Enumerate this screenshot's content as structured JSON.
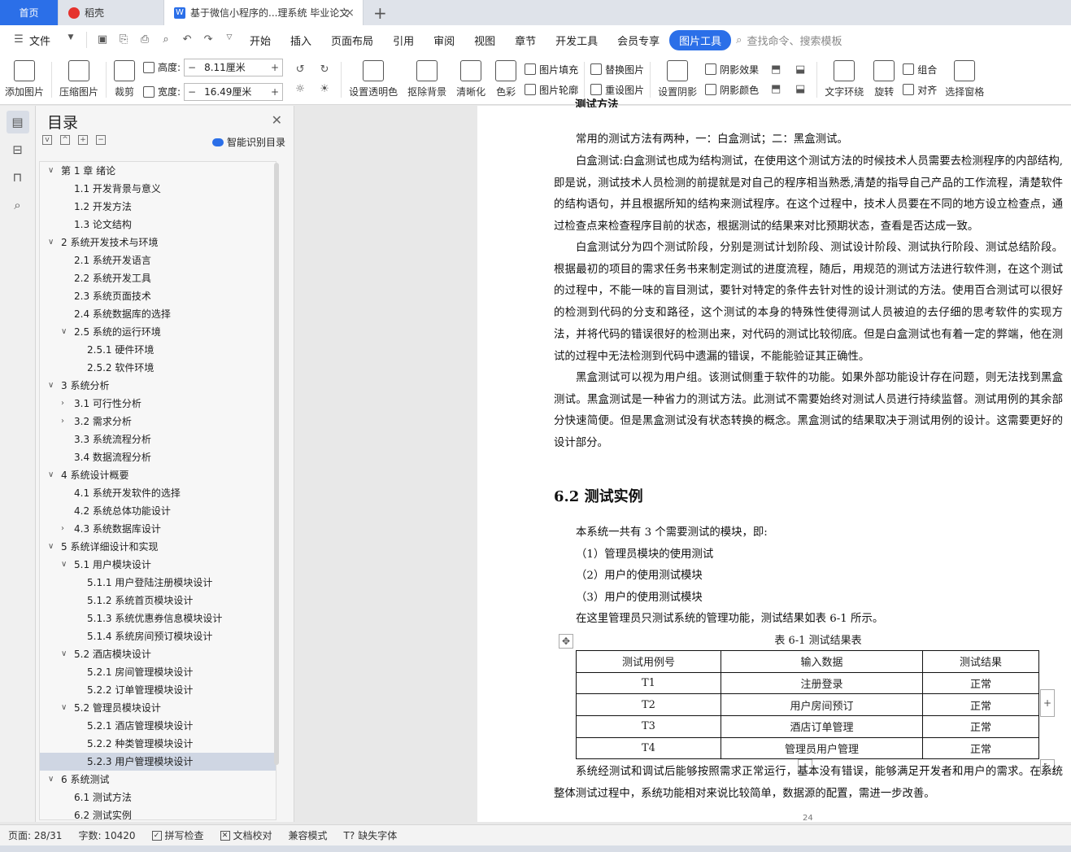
{
  "tabs": {
    "home": "首页",
    "daoke": "稻壳",
    "doc": "基于微信小程序的...理系统 毕业论文",
    "close": "×",
    "new": "+"
  },
  "menu": {
    "file": "文件",
    "items": [
      "开始",
      "插入",
      "页面布局",
      "引用",
      "审阅",
      "视图",
      "章节",
      "开发工具",
      "会员专享"
    ],
    "active": "图片工具",
    "search": "查找命令、搜索模板"
  },
  "ribbon": {
    "add_image": "添加图片",
    "compress": "压缩图片",
    "crop": "裁剪",
    "height_label": "高度:",
    "height_value": "8.11厘米",
    "width_label": "宽度:",
    "width_value": "16.49厘米",
    "set_transparent": "设置透明色",
    "remove_bg": "抠除背景",
    "sharpen": "清晰化",
    "color": "色彩",
    "fill": "图片填充",
    "outline": "图片轮廓",
    "replace": "替换图片",
    "reset": "重设图片",
    "shadow_set": "设置阴影",
    "shadow_effect": "阴影效果",
    "shadow_color": "阴影颜色",
    "text_wrap": "文字环绕",
    "rotate": "旋转",
    "group": "组合",
    "align": "对齐",
    "select_pane": "选择窗格"
  },
  "toc": {
    "title": "目录",
    "smart": "智能识别目录",
    "items": [
      {
        "label": "第 1 章  绪论",
        "level": 1,
        "arrow": "v"
      },
      {
        "label": "1.1 开发背景与意义",
        "level": 2,
        "arrow": ""
      },
      {
        "label": "1.2 开发方法",
        "level": 2,
        "arrow": ""
      },
      {
        "label": "1.3 论文结构",
        "level": 2,
        "arrow": ""
      },
      {
        "label": "2 系统开发技术与环境",
        "level": 1,
        "arrow": "v"
      },
      {
        "label": "2.1  系统开发语言",
        "level": 2,
        "arrow": ""
      },
      {
        "label": "2.2  系统开发工具",
        "level": 2,
        "arrow": ""
      },
      {
        "label": "2.3  系统页面技术",
        "level": 2,
        "arrow": ""
      },
      {
        "label": "2.4  系统数据库的选择",
        "level": 2,
        "arrow": ""
      },
      {
        "label": "2.5  系统的运行环境",
        "level": 2,
        "arrow": "v"
      },
      {
        "label": "2.5.1  硬件环境",
        "level": 3,
        "arrow": ""
      },
      {
        "label": "2.5.2  软件环境",
        "level": 3,
        "arrow": ""
      },
      {
        "label": "3 系统分析",
        "level": 1,
        "arrow": "v"
      },
      {
        "label": "3.1 可行性分析",
        "level": 2,
        "arrow": ">"
      },
      {
        "label": "3.2 需求分析",
        "level": 2,
        "arrow": ">"
      },
      {
        "label": "3.3 系统流程分析",
        "level": 2,
        "arrow": ""
      },
      {
        "label": "3.4 数据流程分析",
        "level": 2,
        "arrow": ""
      },
      {
        "label": "4 系统设计概要",
        "level": 1,
        "arrow": "v"
      },
      {
        "label": "4.1  系统开发软件的选择",
        "level": 2,
        "arrow": ""
      },
      {
        "label": "4.2  系统总体功能设计",
        "level": 2,
        "arrow": ""
      },
      {
        "label": "4.3  系统数据库设计",
        "level": 2,
        "arrow": ">"
      },
      {
        "label": "5 系统详细设计和实现",
        "level": 1,
        "arrow": "v"
      },
      {
        "label": "5.1  用户模块设计",
        "level": 2,
        "arrow": "v"
      },
      {
        "label": "5.1.1  用户登陆注册模块设计",
        "level": 3,
        "arrow": ""
      },
      {
        "label": "5.1.2  系统首页模块设计",
        "level": 3,
        "arrow": ""
      },
      {
        "label": "5.1.3  系统优惠券信息模块设计",
        "level": 3,
        "arrow": ""
      },
      {
        "label": "5.1.4  系统房间预订模块设计",
        "level": 3,
        "arrow": ""
      },
      {
        "label": "5.2  酒店模块设计",
        "level": 2,
        "arrow": "v"
      },
      {
        "label": "5.2.1  房间管理模块设计",
        "level": 3,
        "arrow": ""
      },
      {
        "label": "5.2.2  订单管理模块设计",
        "level": 3,
        "arrow": ""
      },
      {
        "label": "5.2  管理员模块设计",
        "level": 2,
        "arrow": "v"
      },
      {
        "label": "5.2.1  酒店管理模块设计",
        "level": 3,
        "arrow": ""
      },
      {
        "label": "5.2.2  种类管理模块设计",
        "level": 3,
        "arrow": ""
      },
      {
        "label": "5.2.3  用户管理模块设计",
        "level": 3,
        "arrow": "",
        "selected": true
      },
      {
        "label": "6 系统测试",
        "level": 1,
        "arrow": "v"
      },
      {
        "label": "6.1  测试方法",
        "level": 2,
        "arrow": ""
      },
      {
        "label": "6.2  测试实例",
        "level": 2,
        "arrow": ""
      }
    ]
  },
  "doc": {
    "top_fragment": "测试方法",
    "p1": "常用的测试方法有两种，一：白盒测试；二：黑盒测试。",
    "p2": "白盒测试:白盒测试也成为结构测试，在使用这个测试方法的时候技术人员需要去检测程序的内部结构,即是说，测试技术人员检测的前提就是对自己的程序相当熟悉,清楚的指导自己产品的工作流程，清楚软件的结构语句，并且根据所知的结构来测试程序。在这个过程中，技术人员要在不同的地方设立检查点，通过检查点来检查程序目前的状态，根据测试的结果来对比预期状态，查看是否达成一致。",
    "p3": "白盒测试分为四个测试阶段，分别是测试计划阶段、测试设计阶段、测试执行阶段、测试总结阶段。根据最初的项目的需求任务书来制定测试的进度流程，随后，用规范的测试方法进行软件测，在这个测试的过程中，不能一味的盲目测试，要针对特定的条件去针对性的设计测试的方法。使用百合测试可以很好的检测到代码的分支和路径，这个测试的本身的特殊性使得测试人员被迫的去仔细的思考软件的实现方法，并将代码的错误很好的检测出来，对代码的测试比较彻底。但是白盒测试也有着一定的弊端，他在测试的过程中无法检测到代码中遗漏的错误，不能能验证其正确性。",
    "p4": "黑盒测试可以视为用户组。该测试侧重于软件的功能。如果外部功能设计存在问题，则无法找到黑盒测试。黑盒测试是一种省力的测试方法。此测试不需要始终对测试人员进行持续监督。测试用例的其余部分快速简便。但是黑盒测试没有状态转换的概念。黑盒测试的结果取决于测试用例的设计。这需要更好的设计部分。",
    "h2": "6.2  测试实例",
    "p5": "本系统一共有 3 个需要测试的模块，即:",
    "p6": "（1）管理员模块的使用测试",
    "p7": "（2）用户的使用测试模块",
    "p8": "（3）用户的使用测试模块",
    "p9": "在这里管理员只测试系统的管理功能，测试结果如表 6-1 所示。",
    "caption": "表 6-1 测试结果表",
    "table": {
      "headers": [
        "测试用例号",
        "输入数据",
        "测试结果"
      ],
      "rows": [
        [
          "T1",
          "注册登录",
          "正常"
        ],
        [
          "T2",
          "用户房间预订",
          "正常"
        ],
        [
          "T3",
          "酒店订单管理",
          "正常"
        ],
        [
          "T4",
          "管理员用户管理",
          "正常"
        ]
      ]
    },
    "p10": "系统经测试和调试后能够按照需求正常运行，基本没有错误，能够满足开发者和用户的需求。在系统整体测试过程中，系统功能相对来说比较简单，数据源的配置，需进一步改善。",
    "page_number": "24"
  },
  "status": {
    "page": "页面: 28/31",
    "words": "字数: 10420",
    "spell": "拼写检查",
    "proof": "文档校对",
    "compat": "兼容模式",
    "missing_font": "缺失字体"
  }
}
